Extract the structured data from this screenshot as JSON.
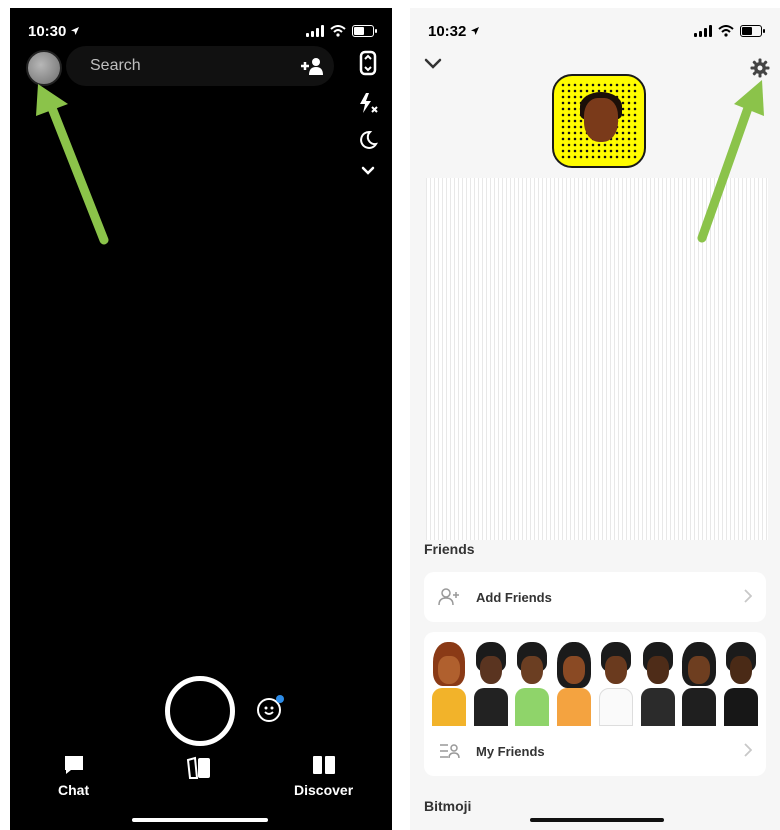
{
  "left_screen": {
    "status": {
      "time": "10:30"
    },
    "search": {
      "placeholder": "Search"
    },
    "nav": {
      "chat_label": "Chat",
      "discover_label": "Discover"
    }
  },
  "right_screen": {
    "status": {
      "time": "10:32"
    },
    "sections": {
      "friends_title": "Friends",
      "add_friends_label": "Add Friends",
      "my_friends_label": "My Friends",
      "bitmoji_title": "Bitmoji"
    }
  },
  "colors": {
    "arrow": "#8bc34a",
    "snapcode_yellow": "#fffc00",
    "lens_dot": "#2d8ce8"
  },
  "icons": [
    "location-arrow-icon",
    "signal-icon",
    "wifi-icon",
    "battery-icon",
    "avatar",
    "search-icon",
    "add-friend-icon",
    "flip-camera-icon",
    "flash-off-icon",
    "night-mode-icon",
    "chevron-down-icon",
    "capture-button",
    "lens-icon",
    "chat-icon",
    "memories-icon",
    "discover-icon",
    "gear-icon",
    "snapcode",
    "add-friend-outline-icon",
    "friends-list-icon"
  ]
}
